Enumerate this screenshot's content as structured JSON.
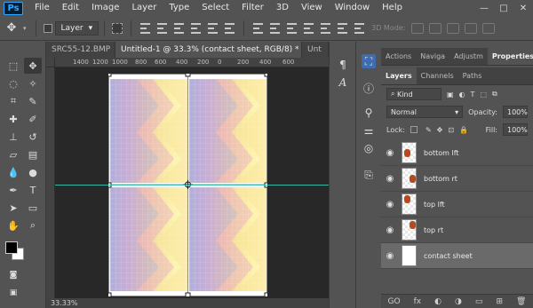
{
  "app": {
    "logo": "Ps"
  },
  "menu": [
    "File",
    "Edit",
    "Image",
    "Layer",
    "Type",
    "Select",
    "Filter",
    "3D",
    "View",
    "Window",
    "Help"
  ],
  "window_controls": [
    "—",
    "□",
    "✕"
  ],
  "options": {
    "auto_select_value": "Layer",
    "mode_label": "3D Mode:"
  },
  "tabs": [
    {
      "label": "SRC55-12.BMP",
      "close": "×"
    },
    {
      "label": "Untitled-1 @ 33.3% (contact sheet, RGB/8) *",
      "close": "×"
    },
    {
      "label": "Unt",
      "close": ""
    }
  ],
  "ruler_labels": [
    "1400",
    "1200",
    "1000",
    "800",
    "600",
    "400",
    "200",
    "0",
    "200",
    "400",
    "600"
  ],
  "status": {
    "zoom": "33.33%"
  },
  "panel_tabs": [
    "Actions",
    "Naviga",
    "Adjustm",
    "Properties"
  ],
  "layers_panel": {
    "tabs": [
      "Layers",
      "Channels",
      "Paths"
    ],
    "filter_kind": "Kind",
    "blend_mode": "Normal",
    "opacity_label": "Opacity:",
    "opacity_value": "100%",
    "lock_label": "Lock:",
    "fill_label": "Fill:",
    "fill_value": "100%",
    "layers": [
      {
        "name": "bottom lft",
        "visible": true,
        "selected": false
      },
      {
        "name": "bottom rt",
        "visible": true,
        "selected": false
      },
      {
        "name": "top lft",
        "visible": true,
        "selected": false
      },
      {
        "name": "top rt",
        "visible": true,
        "selected": false
      },
      {
        "name": "contact sheet",
        "visible": true,
        "selected": true
      }
    ],
    "footer_icons": [
      "GO",
      "fx",
      "◐",
      "◑",
      "▭",
      "⊞",
      "🗑"
    ]
  }
}
